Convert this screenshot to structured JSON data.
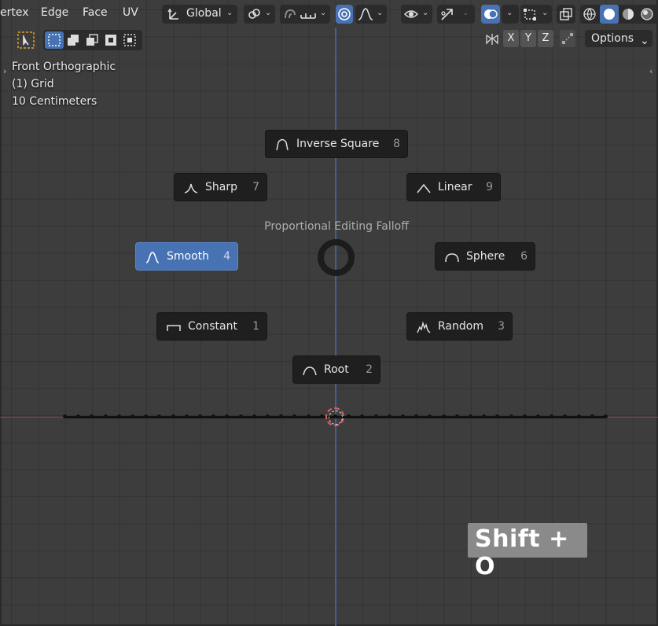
{
  "header": {
    "menu": [
      "ertex",
      "Edge",
      "Face",
      "UV"
    ],
    "transform_orientation": "Global"
  },
  "overlay": {
    "view_name": "Front Orthographic",
    "collection": "(1) Grid",
    "grid_scale": "10 Centimeters"
  },
  "right_toolbar": {
    "axes": [
      "X",
      "Y",
      "Z"
    ],
    "options_label": "Options"
  },
  "pie_menu": {
    "title": "Proportional Editing Falloff",
    "items": [
      {
        "label": "Inverse Square",
        "key": "8",
        "icon": "inverse-square-icon"
      },
      {
        "label": "Sharp",
        "key": "7",
        "icon": "sharp-falloff-icon"
      },
      {
        "label": "Linear",
        "key": "9",
        "icon": "linear-falloff-icon"
      },
      {
        "label": "Smooth",
        "key": "4",
        "icon": "smooth-falloff-icon",
        "active": true
      },
      {
        "label": "Sphere",
        "key": "6",
        "icon": "sphere-falloff-icon"
      },
      {
        "label": "Constant",
        "key": "1",
        "icon": "constant-falloff-icon"
      },
      {
        "label": "Random",
        "key": "3",
        "icon": "random-falloff-icon"
      },
      {
        "label": "Root",
        "key": "2",
        "icon": "root-falloff-icon"
      }
    ]
  },
  "shortcut_display": "Shift + O",
  "colors": {
    "accent": "#4772b3",
    "background": "#3d3d3d",
    "x_axis": "#9a3d3d",
    "y_axis": "#3e6aa8"
  }
}
